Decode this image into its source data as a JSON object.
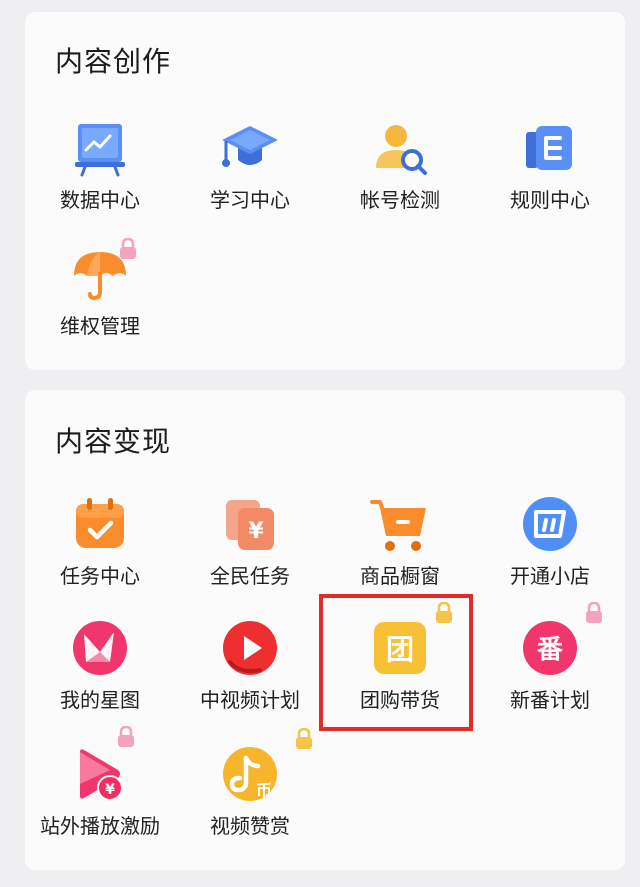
{
  "sections": [
    {
      "title": "内容创作",
      "items": [
        {
          "label": "数据中心",
          "icon": "data-chart-icon",
          "locked": false
        },
        {
          "label": "学习中心",
          "icon": "graduation-cap-icon",
          "locked": false
        },
        {
          "label": "帐号检测",
          "icon": "account-check-icon",
          "locked": false
        },
        {
          "label": "规则中心",
          "icon": "rules-book-icon",
          "locked": false
        },
        {
          "label": "维权管理",
          "icon": "umbrella-icon",
          "locked": true
        }
      ]
    },
    {
      "title": "内容变现",
      "items": [
        {
          "label": "任务中心",
          "icon": "calendar-check-icon",
          "locked": false
        },
        {
          "label": "全民任务",
          "icon": "yuan-card-icon",
          "locked": false
        },
        {
          "label": "商品橱窗",
          "icon": "shopping-cart-icon",
          "locked": false
        },
        {
          "label": "开通小店",
          "icon": "shop-badge-icon",
          "locked": false
        },
        {
          "label": "我的星图",
          "icon": "star-map-icon",
          "locked": false
        },
        {
          "label": "中视频计划",
          "icon": "video-play-icon",
          "locked": false
        },
        {
          "label": "团购带货",
          "icon": "group-buy-icon",
          "locked": true
        },
        {
          "label": "新番计划",
          "icon": "new-series-icon",
          "locked": true
        },
        {
          "label": "站外播放激励",
          "icon": "play-reward-icon",
          "locked": true
        },
        {
          "label": "视频赞赏",
          "icon": "video-tip-icon",
          "locked": true
        }
      ]
    }
  ],
  "icon_glyphs": {
    "group_buy": "团",
    "new_series": "番",
    "yuan": "¥",
    "coin": "币"
  },
  "colors": {
    "highlight": "#e22c2c",
    "lock": "#f3a3bd",
    "lock_gold": "#f5c24b"
  }
}
